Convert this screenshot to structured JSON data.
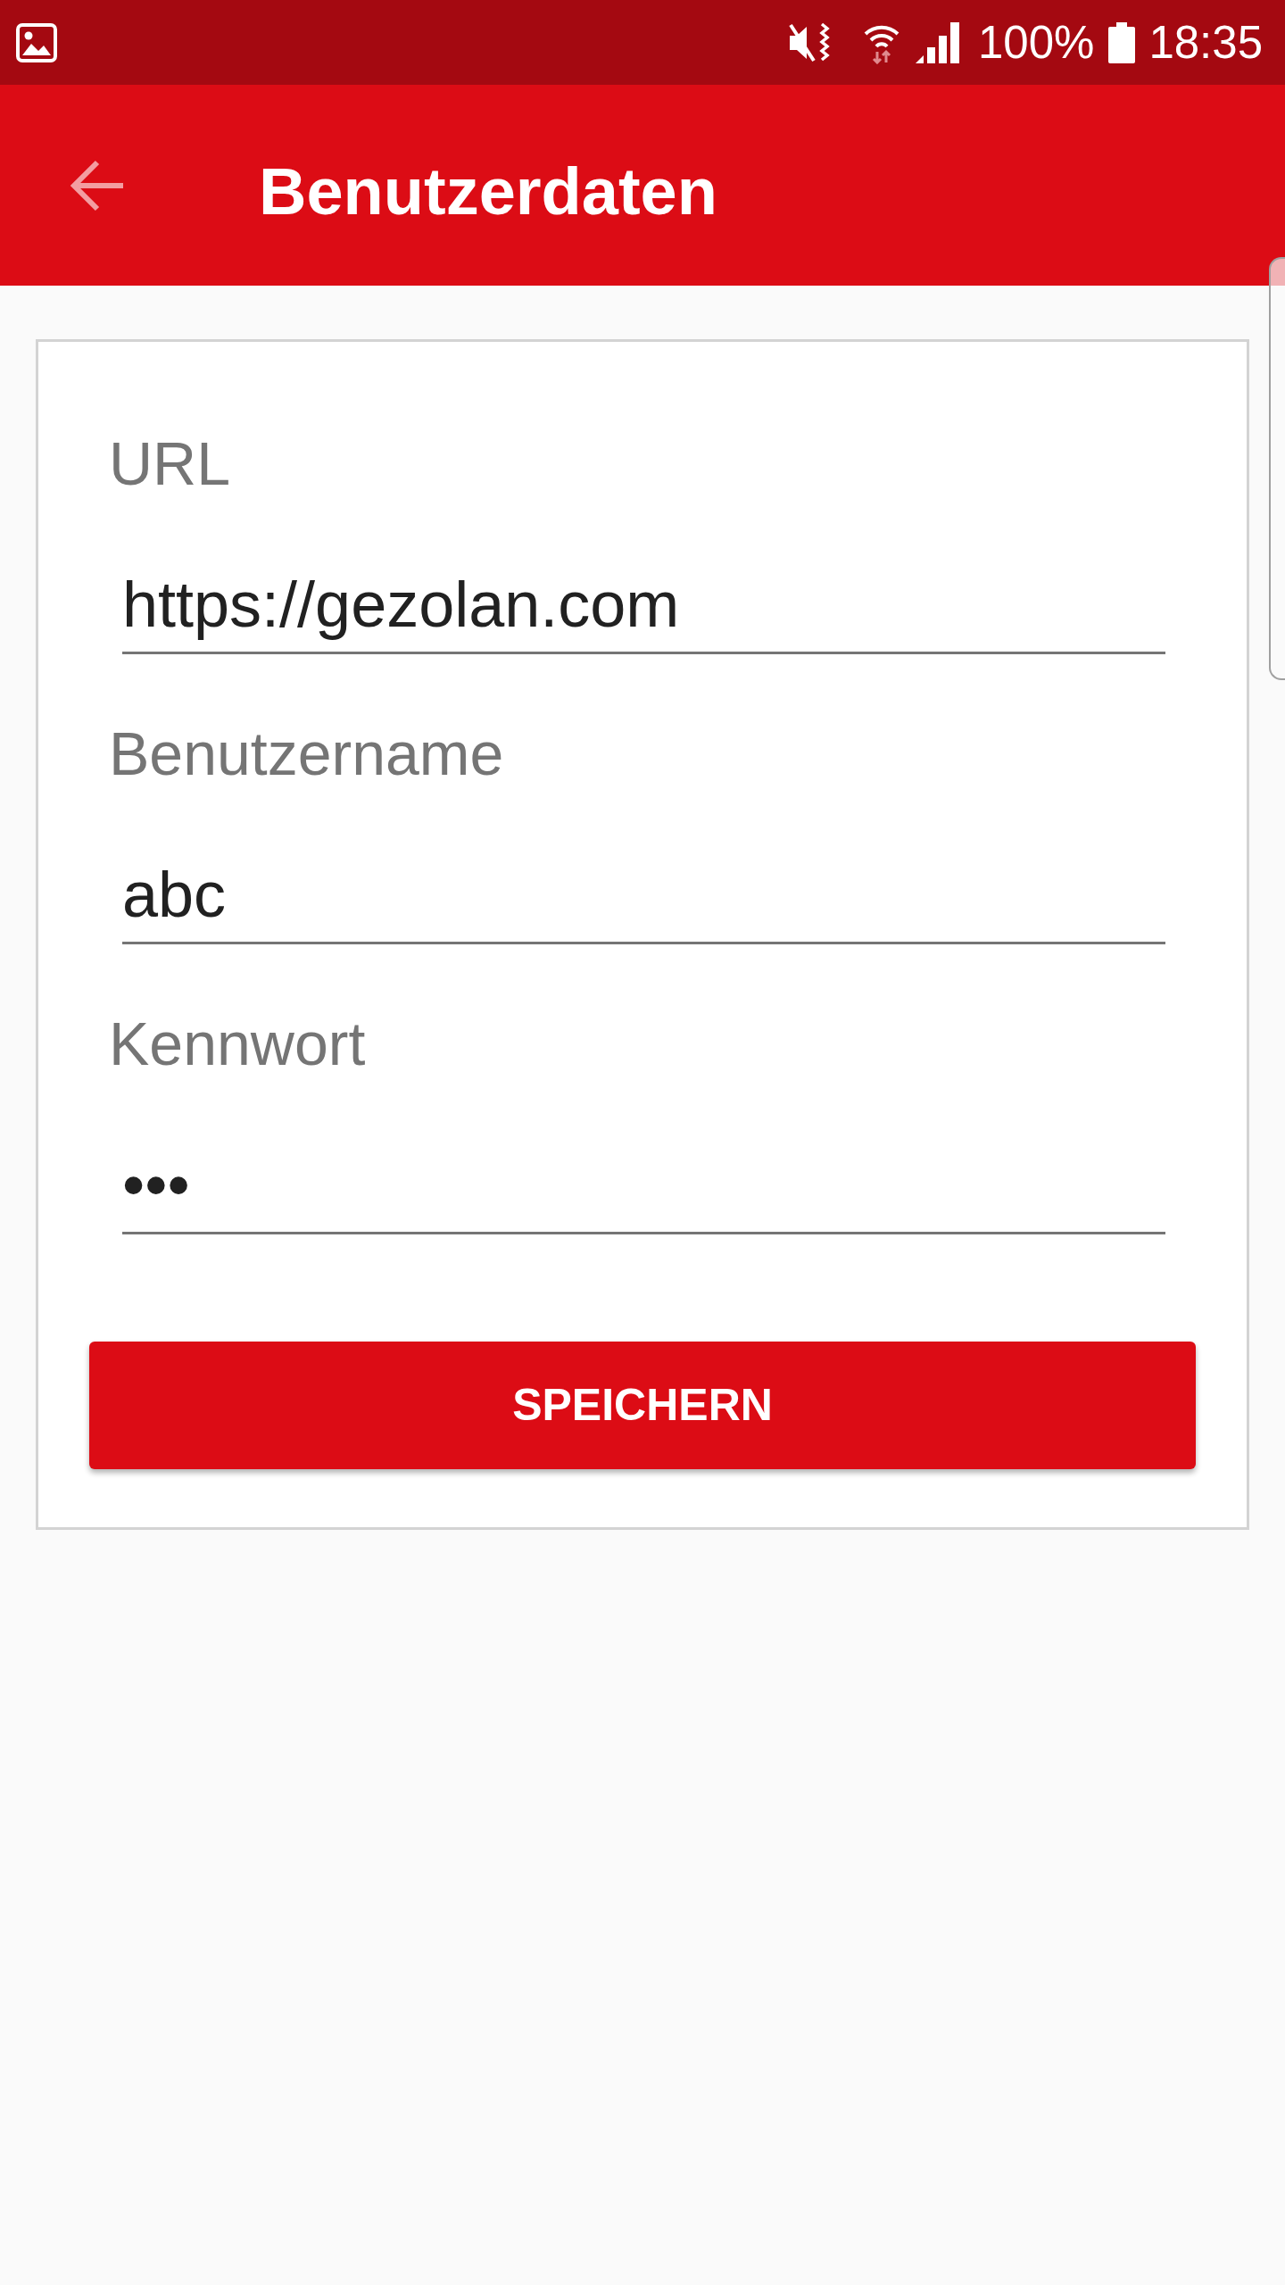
{
  "status_bar": {
    "battery_percent": "100%",
    "time": "18:35"
  },
  "app_bar": {
    "title": "Benutzerdaten"
  },
  "form": {
    "fields": [
      {
        "label": "URL",
        "value": "https://gezolan.com"
      },
      {
        "label": "Benutzername",
        "value": "abc"
      },
      {
        "label": "Kennwort",
        "value": "•••"
      }
    ],
    "save_button": {
      "label": "SPEICHERN"
    }
  }
}
